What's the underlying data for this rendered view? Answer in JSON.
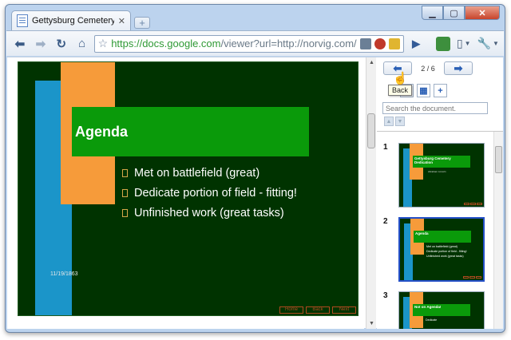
{
  "tab": {
    "title": "Gettysburg Cemetery De..."
  },
  "toolbar": {
    "url_host": "https://docs.google.com",
    "url_rest": "/viewer?url=http://norvig.com/Getty"
  },
  "slide": {
    "title": "Agenda",
    "bullets": [
      "Met on battlefield (great)",
      "Dedicate portion of field - fitting!",
      "Unfinished work (great tasks)"
    ],
    "date": "11/19/1863",
    "nav_buttons": [
      "Home",
      "Back",
      "Next"
    ]
  },
  "panel": {
    "page_indicator": "2 / 6",
    "tooltip": "Back",
    "search_placeholder": "Search the document."
  },
  "thumbnails": [
    {
      "number": "1",
      "title": "Gettysburg Cemetery Dedication",
      "subtitle": "Abraham Lincoln",
      "bullets": []
    },
    {
      "number": "2",
      "title": "Agenda",
      "subtitle": "",
      "bullets": [
        "Met on battlefield (great)",
        "Dedicate portion of field - fitting!",
        "Unfinished work (great tasks)"
      ]
    },
    {
      "number": "3",
      "title": "Not on Agenda!",
      "subtitle": "",
      "bullets": [
        "Dedicate"
      ]
    }
  ],
  "icons": {
    "back": "back-arrow-icon",
    "forward": "forward-arrow-icon",
    "reload": "reload-icon",
    "home": "home-icon",
    "bookmark": "star-icon",
    "page_menu": "page-menu-icon",
    "wrench": "wrench-icon"
  },
  "colors": {
    "slide_background": "#003300",
    "title_bar": "#0a9a0a",
    "orange_bar": "#f69b3a",
    "blue_bar": "#1b95c9",
    "url_host": "#2f9a35",
    "selected_thumb": "#2450c8"
  }
}
